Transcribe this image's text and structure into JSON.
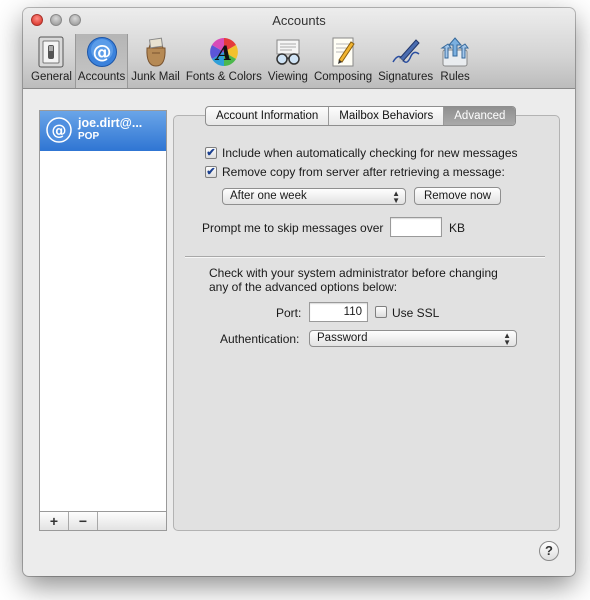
{
  "window": {
    "title": "Accounts"
  },
  "toolbar": {
    "items": [
      {
        "label": "General",
        "icon": "general-switch-icon"
      },
      {
        "label": "Accounts",
        "icon": "accounts-at-icon"
      },
      {
        "label": "Junk Mail",
        "icon": "junk-mail-bag-icon"
      },
      {
        "label": "Fonts & Colors",
        "icon": "fonts-colors-icon"
      },
      {
        "label": "Viewing",
        "icon": "viewing-glasses-icon"
      },
      {
        "label": "Composing",
        "icon": "composing-pencil-icon"
      },
      {
        "label": "Signatures",
        "icon": "signatures-pen-icon"
      },
      {
        "label": "Rules",
        "icon": "rules-arrows-icon"
      }
    ],
    "selected": "Accounts"
  },
  "accounts": {
    "items": [
      {
        "name": "joe.dirt@...",
        "type": "POP",
        "icon": "at-icon"
      }
    ],
    "add_label": "+",
    "remove_label": "−"
  },
  "tabs": [
    {
      "label": "Account Information"
    },
    {
      "label": "Mailbox Behaviors"
    },
    {
      "label": "Advanced"
    }
  ],
  "active_tab": "Advanced",
  "advanced": {
    "include_checking": {
      "label": "Include when automatically checking for new messages",
      "checked": true
    },
    "remove_copy": {
      "label": "Remove copy from server after retrieving a message:",
      "checked": true
    },
    "remove_after": {
      "value": "After one week"
    },
    "remove_now_label": "Remove now",
    "prompt_label": "Prompt me to skip messages over",
    "prompt_value": "",
    "prompt_unit": "KB",
    "admin_note_line1": "Check with your system administrator before changing",
    "admin_note_line2": "any of the advanced options below:",
    "port_label": "Port:",
    "port_value": "110",
    "ssl": {
      "label": "Use SSL",
      "checked": false
    },
    "auth_label": "Authentication:",
    "auth_value": "Password"
  },
  "help_label": "?",
  "colors": {
    "selection": "#3b7fd8",
    "window": "#ececec",
    "panel": "#e1e1e1"
  }
}
